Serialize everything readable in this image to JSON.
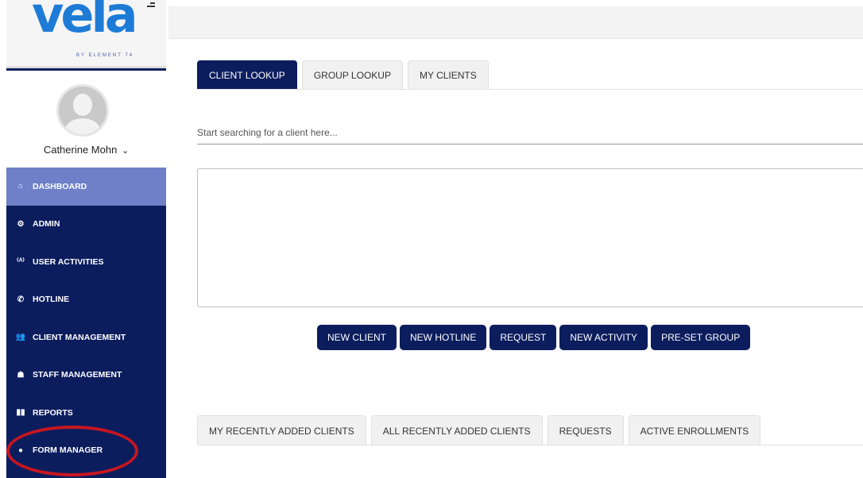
{
  "brand": {
    "logo_text": "vela",
    "tagline": "BY ELEMENT 74"
  },
  "user": {
    "name": "Catherine Mohn",
    "caret": "❯"
  },
  "sidebar": {
    "items": [
      {
        "label": "DASHBOARD",
        "icon": "home-icon",
        "glyph": "⌂",
        "active": true
      },
      {
        "label": "ADMIN",
        "icon": "cogs-icon",
        "glyph": "⚙"
      },
      {
        "label": "USER ACTIVITIES",
        "icon": "broadcast-icon",
        "glyph": "⁽ᴬ⁾"
      },
      {
        "label": "HOTLINE",
        "icon": "phone-icon",
        "glyph": "✆"
      },
      {
        "label": "CLIENT MANAGEMENT",
        "icon": "users-icon",
        "glyph": "👥"
      },
      {
        "label": "STAFF MANAGEMENT",
        "icon": "staff-icon",
        "glyph": "☗"
      },
      {
        "label": "REPORTS",
        "icon": "book-icon",
        "glyph": "▮▮"
      },
      {
        "label": "FORM MANAGER",
        "icon": "info-icon",
        "glyph": "●"
      }
    ]
  },
  "lookup_tabs": [
    "CLIENT LOOKUP",
    "GROUP LOOKUP",
    "MY CLIENTS"
  ],
  "search": {
    "placeholder": "Start searching for a client here..."
  },
  "actions": [
    "NEW CLIENT",
    "NEW HOTLINE",
    "REQUEST",
    "NEW ACTIVITY",
    "PRE-SET GROUP"
  ],
  "bottom_tabs": [
    "MY RECENTLY ADDED CLIENTS",
    "ALL RECENTLY ADDED CLIENTS",
    "REQUESTS",
    "ACTIVE ENROLLMENTS"
  ],
  "colors": {
    "nav_bg": "#0c1d5e",
    "nav_active": "#6f80c9",
    "highlight": "#c7161f"
  }
}
